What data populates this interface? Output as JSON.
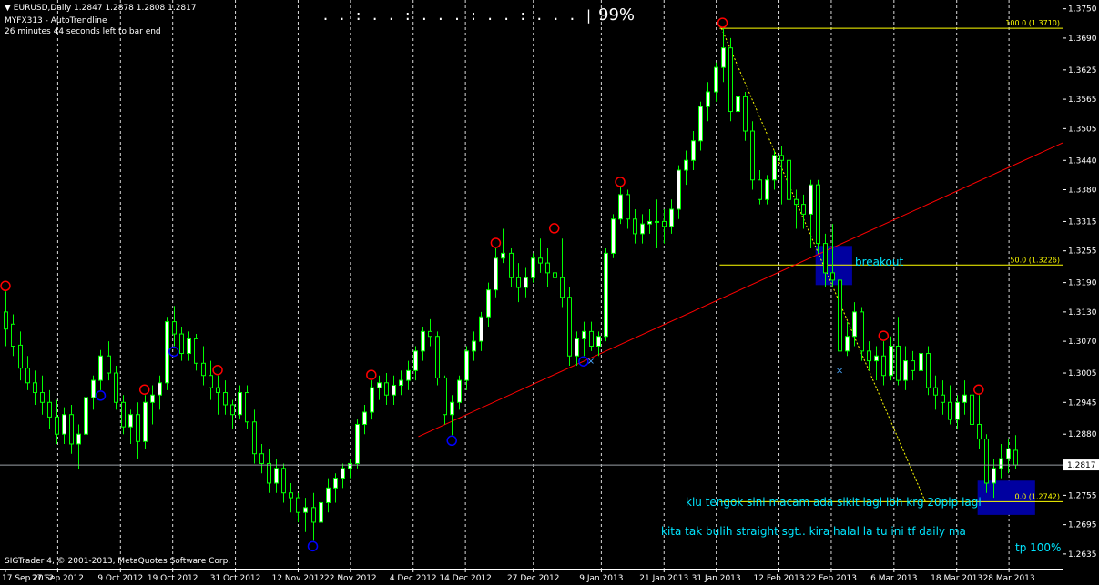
{
  "header": {
    "symbol_line": "EURUSD,Daily  1.2847 1.2878 1.2808 1.2817",
    "indicator_line": "MYFX313 - AutoTrendline",
    "timer_line": "26 minutes 44 seconds left to bar end"
  },
  "progress": {
    "dots": ". . : . . : . . . : . . : . . . |",
    "value": "99%"
  },
  "copyright": "SIGTrader 4, © 2001-2013, MetaQuotes Software Corp.",
  "annotations": {
    "breakout": "breakout",
    "note1": "klu tengok sini macam ada sikit lagi lbh krg 20pip lagi",
    "note2": "kita tak bulih straight sgt.. kira halal la tu ini tf daily ma",
    "tp": "tp 100%"
  },
  "colors": {
    "background": "#000000",
    "bull_candle": "#ffffff",
    "wick": "#00ff00",
    "bear_candle": "#000000",
    "fibo": "#ffff00",
    "trendline": "#ff0000",
    "swing_high": "#ff0000",
    "swing_low": "#0000ff",
    "zone": "#0000a0",
    "note_text": "#00e5ff",
    "vgrid": "#ffffff"
  },
  "chart_data": {
    "type": "candlestick",
    "symbol": "EURUSD",
    "timeframe": "Daily",
    "ohlc_last": {
      "open": 1.2847,
      "high": 1.2878,
      "low": 1.2808,
      "close": 1.2817
    },
    "current_price": "1.2817",
    "ylim": [
      1.2605,
      1.3768
    ],
    "price_ticks": [
      "1.3750",
      "1.3690",
      "1.3625",
      "1.3565",
      "1.3505",
      "1.3440",
      "1.3380",
      "1.3315",
      "1.3255",
      "1.3190",
      "1.3130",
      "1.3070",
      "1.3005",
      "1.2945",
      "1.2880",
      "1.2820",
      "1.2755",
      "1.2695",
      "1.2635"
    ],
    "date_ticks": [
      "17 Sep 2012",
      "27 Sep 2012",
      "9 Oct 2012",
      "19 Oct 2012",
      "31 Oct 2012",
      "12 Nov 2012",
      "22 Nov 2012",
      "4 Dec 2012",
      "14 Dec 2012",
      "27 Dec 2012",
      "9 Jan 2013",
      "21 Jan 2013",
      "31 Jan 2013",
      "12 Feb 2013",
      "22 Feb 2013",
      "6 Mar 2013",
      "18 Mar 2013",
      "28 Mar 2013"
    ],
    "fibo_levels": [
      {
        "level": "100.0",
        "label": "100.0 (1.3710)",
        "price": 1.371
      },
      {
        "level": "50.0",
        "label": "50.0 (1.3226)",
        "price": 1.3226
      },
      {
        "level": "0.0",
        "label": "0.0 (1.2742)",
        "price": 1.2742
      }
    ],
    "trendline": {
      "from": {
        "date": "5 Dec 2012",
        "price": 1.2875
      },
      "to": {
        "date": "3 Apr 2013",
        "price": 1.3455
      }
    },
    "fibo_trend": {
      "from": {
        "date": "1 Feb 2013",
        "price": 1.371
      },
      "to": {
        "date": "12 Mar 2013",
        "price": 1.2742
      }
    },
    "zones": [
      {
        "name": "breakout",
        "from_date": "19 Feb 2013",
        "to_date": "26 Feb 2013",
        "high": 1.3265,
        "low": 1.3185
      },
      {
        "name": "target",
        "from_date": "22 Mar 2013",
        "to_date": "2 Apr 2013",
        "high": 1.2785,
        "low": 1.2715
      }
    ],
    "candles": [
      {
        "o": 1.313,
        "h": 1.3172,
        "l": 1.306,
        "c": 1.3095
      },
      {
        "o": 1.3105,
        "h": 1.3125,
        "l": 1.304,
        "c": 1.306
      },
      {
        "o": 1.3062,
        "h": 1.309,
        "l": 1.299,
        "c": 1.3015
      },
      {
        "o": 1.3015,
        "h": 1.304,
        "l": 1.297,
        "c": 1.2985
      },
      {
        "o": 1.2985,
        "h": 1.301,
        "l": 1.294,
        "c": 1.2965
      },
      {
        "o": 1.2965,
        "h": 1.3,
        "l": 1.292,
        "c": 1.2945
      },
      {
        "o": 1.2945,
        "h": 1.297,
        "l": 1.289,
        "c": 1.2915
      },
      {
        "o": 1.2915,
        "h": 1.295,
        "l": 1.286,
        "c": 1.288
      },
      {
        "o": 1.288,
        "h": 1.2935,
        "l": 1.286,
        "c": 1.292
      },
      {
        "o": 1.292,
        "h": 1.294,
        "l": 1.284,
        "c": 1.286
      },
      {
        "o": 1.286,
        "h": 1.29,
        "l": 1.2808,
        "c": 1.288
      },
      {
        "o": 1.288,
        "h": 1.2965,
        "l": 1.286,
        "c": 1.2955
      },
      {
        "o": 1.2955,
        "h": 1.3,
        "l": 1.293,
        "c": 1.299
      },
      {
        "o": 1.299,
        "h": 1.3052,
        "l": 1.297,
        "c": 1.304
      },
      {
        "o": 1.304,
        "h": 1.307,
        "l": 1.299,
        "c": 1.3005
      },
      {
        "o": 1.3005,
        "h": 1.302,
        "l": 1.293,
        "c": 1.2945
      },
      {
        "o": 1.2945,
        "h": 1.296,
        "l": 1.288,
        "c": 1.2895
      },
      {
        "o": 1.2895,
        "h": 1.293,
        "l": 1.286,
        "c": 1.292
      },
      {
        "o": 1.292,
        "h": 1.2945,
        "l": 1.283,
        "c": 1.2865
      },
      {
        "o": 1.2865,
        "h": 1.296,
        "l": 1.285,
        "c": 1.2945
      },
      {
        "o": 1.2945,
        "h": 1.298,
        "l": 1.29,
        "c": 1.296
      },
      {
        "o": 1.296,
        "h": 1.3,
        "l": 1.293,
        "c": 1.2985
      },
      {
        "o": 1.2985,
        "h": 1.312,
        "l": 1.297,
        "c": 1.311
      },
      {
        "o": 1.311,
        "h": 1.3142,
        "l": 1.306,
        "c": 1.3085
      },
      {
        "o": 1.3085,
        "h": 1.31,
        "l": 1.303,
        "c": 1.3045
      },
      {
        "o": 1.3045,
        "h": 1.309,
        "l": 1.303,
        "c": 1.3075
      },
      {
        "o": 1.3075,
        "h": 1.3085,
        "l": 1.301,
        "c": 1.3025
      },
      {
        "o": 1.3025,
        "h": 1.306,
        "l": 1.298,
        "c": 1.3
      },
      {
        "o": 1.3,
        "h": 1.303,
        "l": 1.295,
        "c": 1.2975
      },
      {
        "o": 1.2975,
        "h": 1.3,
        "l": 1.292,
        "c": 1.2965
      },
      {
        "o": 1.2965,
        "h": 1.299,
        "l": 1.292,
        "c": 1.294
      },
      {
        "o": 1.294,
        "h": 1.295,
        "l": 1.289,
        "c": 1.292
      },
      {
        "o": 1.292,
        "h": 1.298,
        "l": 1.291,
        "c": 1.2965
      },
      {
        "o": 1.2965,
        "h": 1.298,
        "l": 1.289,
        "c": 1.2905
      },
      {
        "o": 1.2905,
        "h": 1.293,
        "l": 1.282,
        "c": 1.284
      },
      {
        "o": 1.284,
        "h": 1.286,
        "l": 1.28,
        "c": 1.282
      },
      {
        "o": 1.282,
        "h": 1.285,
        "l": 1.276,
        "c": 1.278
      },
      {
        "o": 1.278,
        "h": 1.283,
        "l": 1.276,
        "c": 1.281
      },
      {
        "o": 1.281,
        "h": 1.282,
        "l": 1.274,
        "c": 1.276
      },
      {
        "o": 1.276,
        "h": 1.278,
        "l": 1.272,
        "c": 1.275
      },
      {
        "o": 1.275,
        "h": 1.276,
        "l": 1.27,
        "c": 1.272
      },
      {
        "o": 1.272,
        "h": 1.275,
        "l": 1.268,
        "c": 1.273
      },
      {
        "o": 1.273,
        "h": 1.276,
        "l": 1.2662,
        "c": 1.27
      },
      {
        "o": 1.27,
        "h": 1.275,
        "l": 1.269,
        "c": 1.274
      },
      {
        "o": 1.274,
        "h": 1.279,
        "l": 1.272,
        "c": 1.277
      },
      {
        "o": 1.277,
        "h": 1.28,
        "l": 1.274,
        "c": 1.279
      },
      {
        "o": 1.279,
        "h": 1.282,
        "l": 1.277,
        "c": 1.281
      },
      {
        "o": 1.281,
        "h": 1.283,
        "l": 1.279,
        "c": 1.282
      },
      {
        "o": 1.282,
        "h": 1.291,
        "l": 1.281,
        "c": 1.29
      },
      {
        "o": 1.29,
        "h": 1.294,
        "l": 1.288,
        "c": 1.2925
      },
      {
        "o": 1.2925,
        "h": 1.299,
        "l": 1.291,
        "c": 1.2975
      },
      {
        "o": 1.2975,
        "h": 1.3,
        "l": 1.295,
        "c": 1.2985
      },
      {
        "o": 1.2985,
        "h": 1.3005,
        "l": 1.294,
        "c": 1.296
      },
      {
        "o": 1.296,
        "h": 1.3,
        "l": 1.294,
        "c": 1.298
      },
      {
        "o": 1.298,
        "h": 1.301,
        "l": 1.296,
        "c": 1.299
      },
      {
        "o": 1.299,
        "h": 1.303,
        "l": 1.297,
        "c": 1.301
      },
      {
        "o": 1.301,
        "h": 1.306,
        "l": 1.299,
        "c": 1.305
      },
      {
        "o": 1.305,
        "h": 1.31,
        "l": 1.303,
        "c": 1.309
      },
      {
        "o": 1.309,
        "h": 1.3115,
        "l": 1.306,
        "c": 1.308
      },
      {
        "o": 1.308,
        "h": 1.309,
        "l": 1.298,
        "c": 1.2995
      },
      {
        "o": 1.2995,
        "h": 1.3,
        "l": 1.29,
        "c": 1.292
      },
      {
        "o": 1.292,
        "h": 1.296,
        "l": 1.2878,
        "c": 1.2945
      },
      {
        "o": 1.2945,
        "h": 1.3,
        "l": 1.293,
        "c": 1.299
      },
      {
        "o": 1.299,
        "h": 1.306,
        "l": 1.297,
        "c": 1.305
      },
      {
        "o": 1.305,
        "h": 1.309,
        "l": 1.303,
        "c": 1.307
      },
      {
        "o": 1.307,
        "h": 1.313,
        "l": 1.305,
        "c": 1.312
      },
      {
        "o": 1.312,
        "h": 1.319,
        "l": 1.31,
        "c": 1.3175
      },
      {
        "o": 1.3175,
        "h": 1.326,
        "l": 1.316,
        "c": 1.324
      },
      {
        "o": 1.324,
        "h": 1.33,
        "l": 1.323,
        "c": 1.325
      },
      {
        "o": 1.325,
        "h": 1.326,
        "l": 1.318,
        "c": 1.32
      },
      {
        "o": 1.32,
        "h": 1.323,
        "l": 1.315,
        "c": 1.318
      },
      {
        "o": 1.318,
        "h": 1.322,
        "l": 1.316,
        "c": 1.32
      },
      {
        "o": 1.32,
        "h": 1.325,
        "l": 1.319,
        "c": 1.324
      },
      {
        "o": 1.324,
        "h": 1.328,
        "l": 1.321,
        "c": 1.323
      },
      {
        "o": 1.323,
        "h": 1.326,
        "l": 1.318,
        "c": 1.321
      },
      {
        "o": 1.321,
        "h": 1.329,
        "l": 1.319,
        "c": 1.32
      },
      {
        "o": 1.32,
        "h": 1.328,
        "l": 1.314,
        "c": 1.316
      },
      {
        "o": 1.316,
        "h": 1.318,
        "l": 1.302,
        "c": 1.304
      },
      {
        "o": 1.304,
        "h": 1.309,
        "l": 1.302,
        "c": 1.3075
      },
      {
        "o": 1.3075,
        "h": 1.311,
        "l": 1.304,
        "c": 1.309
      },
      {
        "o": 1.309,
        "h": 1.311,
        "l": 1.305,
        "c": 1.306
      },
      {
        "o": 1.306,
        "h": 1.309,
        "l": 1.304,
        "c": 1.308
      },
      {
        "o": 1.308,
        "h": 1.326,
        "l": 1.307,
        "c": 1.325
      },
      {
        "o": 1.325,
        "h": 1.333,
        "l": 1.324,
        "c": 1.332
      },
      {
        "o": 1.332,
        "h": 1.3385,
        "l": 1.331,
        "c": 1.337
      },
      {
        "o": 1.337,
        "h": 1.338,
        "l": 1.33,
        "c": 1.332
      },
      {
        "o": 1.332,
        "h": 1.334,
        "l": 1.327,
        "c": 1.329
      },
      {
        "o": 1.329,
        "h": 1.333,
        "l": 1.327,
        "c": 1.331
      },
      {
        "o": 1.331,
        "h": 1.334,
        "l": 1.329,
        "c": 1.3315
      },
      {
        "o": 1.3315,
        "h": 1.336,
        "l": 1.326,
        "c": 1.3315
      },
      {
        "o": 1.3315,
        "h": 1.334,
        "l": 1.327,
        "c": 1.3305
      },
      {
        "o": 1.3305,
        "h": 1.336,
        "l": 1.329,
        "c": 1.334
      },
      {
        "o": 1.334,
        "h": 1.343,
        "l": 1.332,
        "c": 1.342
      },
      {
        "o": 1.342,
        "h": 1.346,
        "l": 1.339,
        "c": 1.344
      },
      {
        "o": 1.344,
        "h": 1.35,
        "l": 1.342,
        "c": 1.348
      },
      {
        "o": 1.348,
        "h": 1.356,
        "l": 1.346,
        "c": 1.355
      },
      {
        "o": 1.355,
        "h": 1.36,
        "l": 1.352,
        "c": 1.358
      },
      {
        "o": 1.358,
        "h": 1.364,
        "l": 1.356,
        "c": 1.363
      },
      {
        "o": 1.363,
        "h": 1.371,
        "l": 1.36,
        "c": 1.367
      },
      {
        "o": 1.367,
        "h": 1.369,
        "l": 1.352,
        "c": 1.354
      },
      {
        "o": 1.354,
        "h": 1.36,
        "l": 1.348,
        "c": 1.357
      },
      {
        "o": 1.357,
        "h": 1.358,
        "l": 1.348,
        "c": 1.35
      },
      {
        "o": 1.35,
        "h": 1.352,
        "l": 1.338,
        "c": 1.34
      },
      {
        "o": 1.34,
        "h": 1.342,
        "l": 1.335,
        "c": 1.336
      },
      {
        "o": 1.336,
        "h": 1.341,
        "l": 1.335,
        "c": 1.34
      },
      {
        "o": 1.34,
        "h": 1.346,
        "l": 1.338,
        "c": 1.345
      },
      {
        "o": 1.345,
        "h": 1.347,
        "l": 1.335,
        "c": 1.344
      },
      {
        "o": 1.344,
        "h": 1.346,
        "l": 1.333,
        "c": 1.336
      },
      {
        "o": 1.336,
        "h": 1.338,
        "l": 1.33,
        "c": 1.335
      },
      {
        "o": 1.335,
        "h": 1.337,
        "l": 1.33,
        "c": 1.333
      },
      {
        "o": 1.333,
        "h": 1.34,
        "l": 1.326,
        "c": 1.339
      },
      {
        "o": 1.339,
        "h": 1.34,
        "l": 1.325,
        "c": 1.327
      },
      {
        "o": 1.327,
        "h": 1.329,
        "l": 1.318,
        "c": 1.321
      },
      {
        "o": 1.321,
        "h": 1.331,
        "l": 1.318,
        "c": 1.3195
      },
      {
        "o": 1.3195,
        "h": 1.321,
        "l": 1.303,
        "c": 1.305
      },
      {
        "o": 1.305,
        "h": 1.311,
        "l": 1.304,
        "c": 1.308
      },
      {
        "o": 1.308,
        "h": 1.315,
        "l": 1.306,
        "c": 1.313
      },
      {
        "o": 1.313,
        "h": 1.314,
        "l": 1.303,
        "c": 1.305
      },
      {
        "o": 1.305,
        "h": 1.307,
        "l": 1.301,
        "c": 1.303
      },
      {
        "o": 1.303,
        "h": 1.306,
        "l": 1.299,
        "c": 1.304
      },
      {
        "o": 1.304,
        "h": 1.307,
        "l": 1.298,
        "c": 1.3
      },
      {
        "o": 1.3,
        "h": 1.308,
        "l": 1.299,
        "c": 1.306
      },
      {
        "o": 1.306,
        "h": 1.312,
        "l": 1.298,
        "c": 1.299
      },
      {
        "o": 1.299,
        "h": 1.306,
        "l": 1.297,
        "c": 1.303
      },
      {
        "o": 1.303,
        "h": 1.305,
        "l": 1.299,
        "c": 1.301
      },
      {
        "o": 1.301,
        "h": 1.306,
        "l": 1.298,
        "c": 1.3045
      },
      {
        "o": 1.3045,
        "h": 1.306,
        "l": 1.296,
        "c": 1.2975
      },
      {
        "o": 1.2975,
        "h": 1.3,
        "l": 1.293,
        "c": 1.296
      },
      {
        "o": 1.296,
        "h": 1.299,
        "l": 1.292,
        "c": 1.2945
      },
      {
        "o": 1.2945,
        "h": 1.298,
        "l": 1.29,
        "c": 1.291
      },
      {
        "o": 1.291,
        "h": 1.296,
        "l": 1.289,
        "c": 1.2945
      },
      {
        "o": 1.2945,
        "h": 1.299,
        "l": 1.292,
        "c": 1.296
      },
      {
        "o": 1.296,
        "h": 1.3045,
        "l": 1.288,
        "c": 1.29
      },
      {
        "o": 1.29,
        "h": 1.296,
        "l": 1.285,
        "c": 1.287
      },
      {
        "o": 1.287,
        "h": 1.288,
        "l": 1.276,
        "c": 1.278
      },
      {
        "o": 1.278,
        "h": 1.283,
        "l": 1.275,
        "c": 1.281
      },
      {
        "o": 1.281,
        "h": 1.286,
        "l": 1.279,
        "c": 1.283
      },
      {
        "o": 1.283,
        "h": 1.287,
        "l": 1.28,
        "c": 1.285
      },
      {
        "o": 1.2847,
        "h": 1.2878,
        "l": 1.2808,
        "c": 1.2817
      }
    ],
    "swing_highs": [
      0,
      19,
      29,
      50,
      67,
      75,
      84,
      98,
      120,
      133
    ],
    "swing_lows": [
      13,
      23,
      42,
      61,
      79
    ],
    "cross_marks": [
      80,
      114
    ]
  }
}
